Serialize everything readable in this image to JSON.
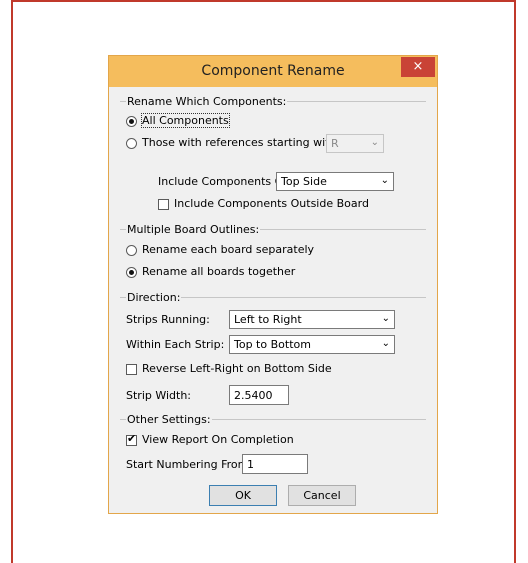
{
  "dialog": {
    "title": "Component Rename",
    "close_glyph": "×"
  },
  "rename_which": {
    "group_label": "Rename Which Components:",
    "all_label": "All Components",
    "all_selected": true,
    "prefix_label": "Those with references starting with:",
    "prefix_selected": false,
    "prefix_value": "R",
    "include_on_label": "Include Components On:",
    "include_on_value": "Top Side",
    "outside_board_label": "Include Components Outside Board",
    "outside_board_checked": false
  },
  "board_outlines": {
    "group_label": "Multiple Board Outlines:",
    "separate_label": "Rename each board separately",
    "separate_selected": false,
    "together_label": "Rename all boards together",
    "together_selected": true
  },
  "direction": {
    "group_label": "Direction:",
    "strips_running_label": "Strips Running:",
    "strips_running_value": "Left to Right",
    "within_strip_label": "Within Each Strip:",
    "within_strip_value": "Top to Bottom",
    "reverse_label": "Reverse Left-Right on Bottom Side",
    "reverse_checked": false,
    "strip_width_label": "Strip Width:",
    "strip_width_value": "2.5400"
  },
  "other": {
    "group_label": "Other Settings:",
    "view_report_label": "View Report On Completion",
    "view_report_checked": true,
    "start_numbering_label": "Start Numbering From:",
    "start_numbering_value": "1"
  },
  "buttons": {
    "ok_label": "OK",
    "cancel_label": "Cancel"
  },
  "glyphs": {
    "dropdown": "⌄",
    "tick": "✔"
  },
  "colors": {
    "titlebar": "#f5bd5d",
    "close": "#c94336",
    "frame": "#c0392b"
  }
}
